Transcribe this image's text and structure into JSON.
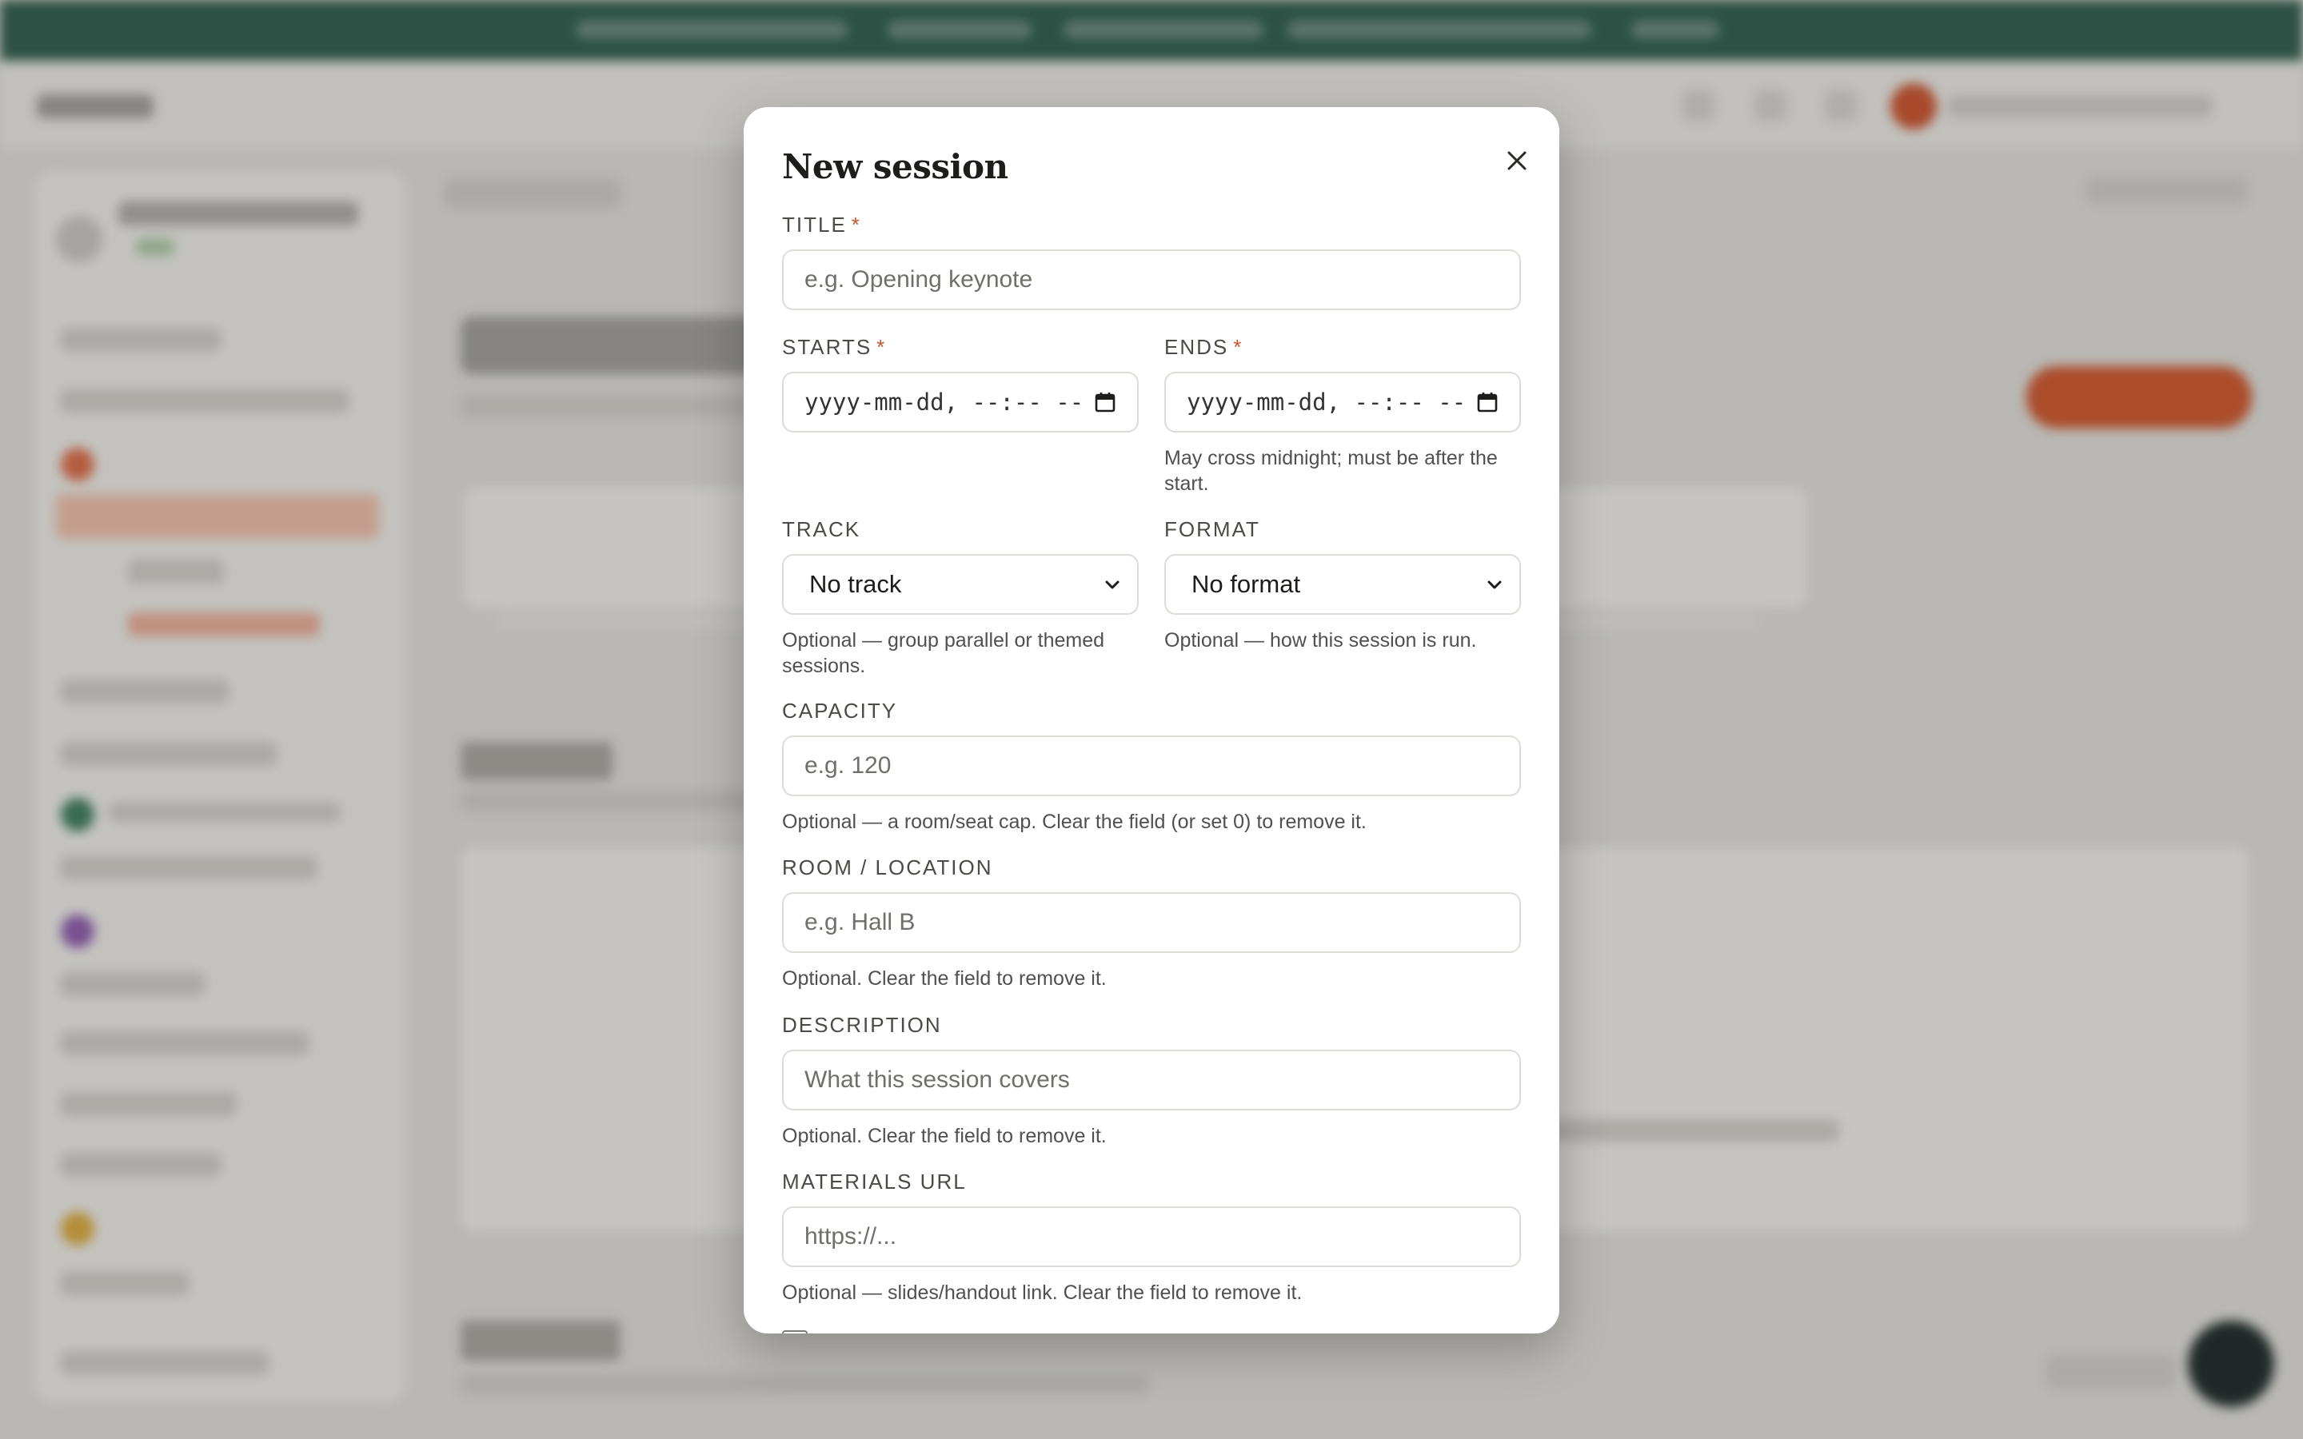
{
  "modal": {
    "title": "New session",
    "close_icon": "close-icon",
    "fields": {
      "title": {
        "label": "TITLE",
        "required_mark": "*",
        "placeholder": "e.g. Opening keynote"
      },
      "starts": {
        "label": "STARTS",
        "required_mark": "*",
        "value": "yyyy-mm-dd, --:-- --",
        "icon": "calendar-icon"
      },
      "ends": {
        "label": "ENDS",
        "required_mark": "*",
        "value": "yyyy-mm-dd, --:-- --",
        "icon": "calendar-icon",
        "help": "May cross midnight; must be after the start."
      },
      "track": {
        "label": "TRACK",
        "selected": "No track",
        "help": "Optional — group parallel or themed sessions."
      },
      "format": {
        "label": "FORMAT",
        "selected": "No format",
        "help": "Optional — how this session is run."
      },
      "capacity": {
        "label": "CAPACITY",
        "placeholder": "e.g. 120",
        "help": "Optional — a room/seat cap. Clear the field (or set 0) to remove it."
      },
      "room": {
        "label": "ROOM / LOCATION",
        "placeholder": "e.g. Hall B",
        "help": "Optional. Clear the field to remove it."
      },
      "description": {
        "label": "DESCRIPTION",
        "placeholder": "What this session covers",
        "help": "Optional. Clear the field to remove it."
      },
      "materials": {
        "label": "MATERIALS URL",
        "placeholder": "https://...",
        "help": "Optional — slides/handout link. Clear the field to remove it."
      }
    }
  },
  "colors": {
    "accent": "#c8552c",
    "banner": "#2f5b4c",
    "modal_bg": "#ffffff",
    "border": "#dddcd8"
  }
}
